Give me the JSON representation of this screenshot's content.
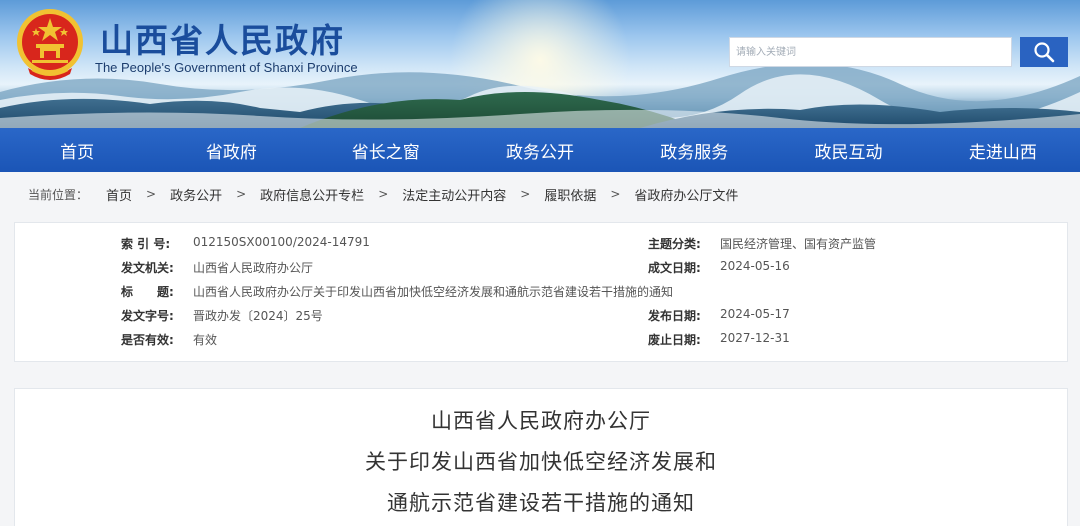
{
  "header": {
    "title": "山西省人民政府",
    "subtitle": "The People's Government of Shanxi Province",
    "search_placeholder": "请输入关键词",
    "search_icon": "search-icon",
    "emblem_icon": "national-emblem-icon"
  },
  "nav": {
    "items": [
      {
        "label": "首页"
      },
      {
        "label": "省政府"
      },
      {
        "label": "省长之窗"
      },
      {
        "label": "政务公开"
      },
      {
        "label": "政务服务"
      },
      {
        "label": "政民互动"
      },
      {
        "label": "走进山西"
      }
    ]
  },
  "breadcrumb": {
    "label": "当前位置：",
    "separator": ">",
    "items": [
      "首页",
      "政务公开",
      "政府信息公开专栏",
      "法定主动公开内容",
      "履职依据",
      "省政府办公厅文件"
    ]
  },
  "meta": {
    "index_no_key": "索 引 号:",
    "index_no": "012150SX00100/2024-14791",
    "topic_key": "主题分类:",
    "topic": "国民经济管理、国有资产监管",
    "issuer_key": "发文机关:",
    "issuer": "山西省人民政府办公厅",
    "created_key": "成文日期:",
    "created": "2024-05-16",
    "title_key": "标　　题:",
    "title": "山西省人民政府办公厅关于印发山西省加快低空经济发展和通航示范省建设若干措施的通知",
    "doc_no_key": "发文字号:",
    "doc_no": "晋政办发〔2024〕25号",
    "published_key": "发布日期:",
    "published": "2024-05-17",
    "valid_key": "是否有效:",
    "valid": "有效",
    "expire_key": "废止日期:",
    "expire": "2027-12-31"
  },
  "document": {
    "heading_line1": "山西省人民政府办公厅",
    "heading_line2": "关于印发山西省加快低空经济发展和",
    "heading_line3": "通航示范省建设若干措施的通知"
  },
  "colors": {
    "brand_blue": "#1b55b6",
    "title_blue": "#1a4d9c",
    "emblem_red": "#d8261c",
    "emblem_gold": "#f1c232"
  }
}
